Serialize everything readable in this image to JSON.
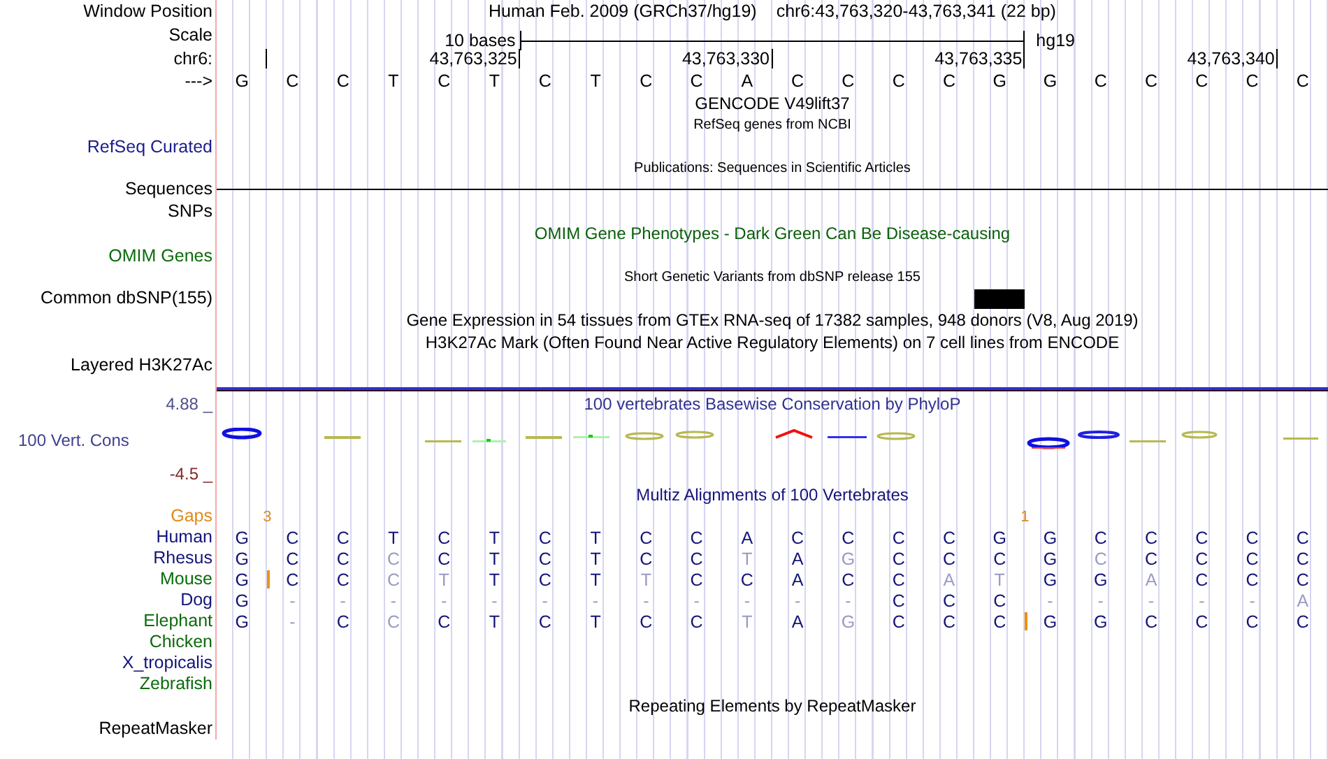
{
  "header": {
    "label": "Window Position",
    "assembly": "Human Feb. 2009 (GRCh37/hg19)",
    "position": "chr6:43,763,320-43,763,341 (22 bp)"
  },
  "scale": {
    "label": "Scale",
    "span": "10 bases",
    "assembly": "hg19"
  },
  "ruler": {
    "label": "chr6:",
    "ticks": [
      "43,763,325",
      "43,763,330",
      "43,763,335",
      "43,763,340"
    ]
  },
  "sequence": {
    "label": "--->",
    "bases": [
      "G",
      "C",
      "C",
      "T",
      "C",
      "T",
      "C",
      "T",
      "C",
      "C",
      "A",
      "C",
      "C",
      "C",
      "C",
      "G",
      "G",
      "C",
      "C",
      "C",
      "C",
      "C"
    ]
  },
  "tracks": [
    {
      "kind": "title",
      "text": "GENCODE V49lift37",
      "color": "#000000"
    },
    {
      "kind": "note",
      "text": "RefSeq genes from NCBI",
      "color": "#000000"
    },
    {
      "kind": "label",
      "label": "RefSeq Curated",
      "color": "#1c1c8c"
    },
    {
      "kind": "note",
      "text": "Publications: Sequences in Scientific Articles",
      "color": "#000000"
    },
    {
      "kind": "line",
      "label": "Sequences",
      "color": "#000000"
    },
    {
      "kind": "label",
      "label": "SNPs",
      "color": "#000000"
    },
    {
      "kind": "title",
      "text": "OMIM Gene Phenotypes - Dark Green Can Be Disease-causing",
      "color": "#0b5f0b"
    },
    {
      "kind": "label",
      "label": "OMIM Genes",
      "color": "#0b6b0b"
    },
    {
      "kind": "note",
      "text": "Short Genetic Variants from dbSNP release 155",
      "color": "#000000"
    },
    {
      "kind": "snp",
      "label": "Common dbSNP(155)",
      "color": "#000000"
    },
    {
      "kind": "title",
      "text": "Gene Expression in 54 tissues from GTEx RNA-seq of 17382 samples, 948 donors (V8, Aug 2019)",
      "color": "#000000"
    },
    {
      "kind": "title",
      "text": "H3K27Ac Mark (Often Found Near Active Regulatory Elements) on 7 cell lines from ENCODE",
      "color": "#000000"
    },
    {
      "kind": "label",
      "label": "Layered H3K27Ac",
      "color": "#000000"
    },
    {
      "kind": "conservation",
      "title": "100 vertebrates Basewise Conservation by PhyloP",
      "label": "100 Vert. Cons",
      "max": "4.88 _",
      "min": "-4.5 _"
    },
    {
      "kind": "alignment",
      "title": "Multiz Alignments of 100 Vertebrates",
      "gaps_label": "Gaps",
      "species": [
        {
          "name": "Human",
          "color": "#14147a",
          "bases": [
            {
              "kind": "base",
              "b": "G",
              "dim": false
            },
            {
              "kind": "base",
              "b": "C",
              "dim": false
            },
            {
              "kind": "base",
              "b": "C",
              "dim": false
            },
            {
              "kind": "base",
              "b": "T",
              "dim": false
            },
            {
              "kind": "base",
              "b": "C",
              "dim": false
            },
            {
              "kind": "base",
              "b": "T",
              "dim": false
            },
            {
              "kind": "base",
              "b": "C",
              "dim": false
            },
            {
              "kind": "base",
              "b": "T",
              "dim": false
            },
            {
              "kind": "base",
              "b": "C",
              "dim": false
            },
            {
              "kind": "base",
              "b": "C",
              "dim": false
            },
            {
              "kind": "base",
              "b": "A",
              "dim": false
            },
            {
              "kind": "base",
              "b": "C",
              "dim": false
            },
            {
              "kind": "base",
              "b": "C",
              "dim": false
            },
            {
              "kind": "base",
              "b": "C",
              "dim": false
            },
            {
              "kind": "base",
              "b": "C",
              "dim": false
            },
            {
              "kind": "base",
              "b": "G",
              "dim": false
            },
            {
              "kind": "base",
              "b": "G",
              "dim": false
            },
            {
              "kind": "base",
              "b": "C",
              "dim": false
            },
            {
              "kind": "base",
              "b": "C",
              "dim": false
            },
            {
              "kind": "base",
              "b": "C",
              "dim": false
            },
            {
              "kind": "base",
              "b": "C",
              "dim": false
            },
            {
              "kind": "base",
              "b": "C",
              "dim": false
            }
          ]
        },
        {
          "name": "Rhesus",
          "color": "#14147a",
          "bases": [
            {
              "kind": "base",
              "b": "G",
              "dim": false
            },
            {
              "kind": "base",
              "b": "C",
              "dim": false
            },
            {
              "kind": "base",
              "b": "C",
              "dim": false
            },
            {
              "kind": "base",
              "b": "C",
              "dim": true
            },
            {
              "kind": "base",
              "b": "C",
              "dim": false
            },
            {
              "kind": "base",
              "b": "T",
              "dim": false
            },
            {
              "kind": "base",
              "b": "C",
              "dim": false
            },
            {
              "kind": "base",
              "b": "T",
              "dim": false
            },
            {
              "kind": "base",
              "b": "C",
              "dim": false
            },
            {
              "kind": "base",
              "b": "C",
              "dim": false
            },
            {
              "kind": "base",
              "b": "T",
              "dim": true
            },
            {
              "kind": "base",
              "b": "A",
              "dim": false
            },
            {
              "kind": "base",
              "b": "G",
              "dim": true
            },
            {
              "kind": "base",
              "b": "C",
              "dim": false
            },
            {
              "kind": "base",
              "b": "C",
              "dim": false
            },
            {
              "kind": "base",
              "b": "C",
              "dim": false
            },
            {
              "kind": "base",
              "b": "G",
              "dim": false
            },
            {
              "kind": "base",
              "b": "C",
              "dim": true
            },
            {
              "kind": "base",
              "b": "C",
              "dim": false
            },
            {
              "kind": "base",
              "b": "C",
              "dim": false
            },
            {
              "kind": "base",
              "b": "C",
              "dim": false
            },
            {
              "kind": "base",
              "b": "C",
              "dim": false
            }
          ]
        },
        {
          "name": "Mouse",
          "color": "#0b6b0b",
          "bases": [
            {
              "kind": "base",
              "b": "G",
              "dim": false
            },
            {
              "kind": "insert",
              "gap": "3"
            },
            {
              "kind": "base",
              "b": "C",
              "dim": false
            },
            {
              "kind": "base",
              "b": "C",
              "dim": false
            },
            {
              "kind": "base",
              "b": "C",
              "dim": true
            },
            {
              "kind": "base",
              "b": "T",
              "dim": true
            },
            {
              "kind": "base",
              "b": "T",
              "dim": false
            },
            {
              "kind": "base",
              "b": "C",
              "dim": false
            },
            {
              "kind": "base",
              "b": "T",
              "dim": false
            },
            {
              "kind": "base",
              "b": "T",
              "dim": true
            },
            {
              "kind": "base",
              "b": "C",
              "dim": false
            },
            {
              "kind": "base",
              "b": "C",
              "dim": false
            },
            {
              "kind": "base",
              "b": "A",
              "dim": false
            },
            {
              "kind": "base",
              "b": "C",
              "dim": false
            },
            {
              "kind": "base",
              "b": "C",
              "dim": false
            },
            {
              "kind": "base",
              "b": "A",
              "dim": true
            },
            {
              "kind": "base",
              "b": "T",
              "dim": true
            },
            {
              "kind": "base",
              "b": "G",
              "dim": false
            },
            {
              "kind": "base",
              "b": "G",
              "dim": false
            },
            {
              "kind": "base",
              "b": "A",
              "dim": true
            },
            {
              "kind": "base",
              "b": "C",
              "dim": false
            },
            {
              "kind": "base",
              "b": "C",
              "dim": false
            },
            {
              "kind": "base",
              "b": "C",
              "dim": false
            }
          ]
        },
        {
          "name": "Dog",
          "color": "#14147a",
          "bases": [
            {
              "kind": "base",
              "b": "G",
              "dim": false
            },
            {
              "kind": "base",
              "b": "-",
              "dim": true
            },
            {
              "kind": "base",
              "b": "-",
              "dim": true
            },
            {
              "kind": "base",
              "b": "-",
              "dim": true
            },
            {
              "kind": "base",
              "b": "-",
              "dim": true
            },
            {
              "kind": "base",
              "b": "-",
              "dim": true
            },
            {
              "kind": "base",
              "b": "-",
              "dim": true
            },
            {
              "kind": "base",
              "b": "-",
              "dim": true
            },
            {
              "kind": "base",
              "b": "-",
              "dim": true
            },
            {
              "kind": "base",
              "b": "-",
              "dim": true
            },
            {
              "kind": "base",
              "b": "-",
              "dim": true
            },
            {
              "kind": "base",
              "b": "-",
              "dim": true
            },
            {
              "kind": "base",
              "b": "-",
              "dim": true
            },
            {
              "kind": "base",
              "b": "C",
              "dim": false
            },
            {
              "kind": "base",
              "b": "C",
              "dim": false
            },
            {
              "kind": "base",
              "b": "C",
              "dim": false
            },
            {
              "kind": "base",
              "b": "-",
              "dim": true
            },
            {
              "kind": "base",
              "b": "-",
              "dim": true
            },
            {
              "kind": "base",
              "b": "-",
              "dim": true
            },
            {
              "kind": "base",
              "b": "-",
              "dim": true
            },
            {
              "kind": "base",
              "b": "-",
              "dim": true
            },
            {
              "kind": "base",
              "b": "A",
              "dim": true
            }
          ]
        },
        {
          "name": "Elephant",
          "color": "#0b6b0b",
          "bases": [
            {
              "kind": "base",
              "b": "G",
              "dim": false
            },
            {
              "kind": "base",
              "b": "-",
              "dim": true
            },
            {
              "kind": "base",
              "b": "C",
              "dim": false
            },
            {
              "kind": "base",
              "b": "C",
              "dim": true
            },
            {
              "kind": "base",
              "b": "C",
              "dim": false
            },
            {
              "kind": "base",
              "b": "T",
              "dim": false
            },
            {
              "kind": "base",
              "b": "C",
              "dim": false
            },
            {
              "kind": "base",
              "b": "T",
              "dim": false
            },
            {
              "kind": "base",
              "b": "C",
              "dim": false
            },
            {
              "kind": "base",
              "b": "C",
              "dim": false
            },
            {
              "kind": "base",
              "b": "T",
              "dim": true
            },
            {
              "kind": "base",
              "b": "A",
              "dim": false
            },
            {
              "kind": "base",
              "b": "G",
              "dim": true
            },
            {
              "kind": "base",
              "b": "C",
              "dim": false
            },
            {
              "kind": "base",
              "b": "C",
              "dim": false
            },
            {
              "kind": "base",
              "b": "C",
              "dim": false
            },
            {
              "kind": "insert",
              "gap": "1"
            },
            {
              "kind": "base",
              "b": "G",
              "dim": false
            },
            {
              "kind": "base",
              "b": "G",
              "dim": false
            },
            {
              "kind": "base",
              "b": "C",
              "dim": false
            },
            {
              "kind": "base",
              "b": "C",
              "dim": false
            },
            {
              "kind": "base",
              "b": "C",
              "dim": false
            },
            {
              "kind": "base",
              "b": "C",
              "dim": false
            }
          ]
        },
        {
          "name": "Chicken",
          "color": "#0b6b0b"
        },
        {
          "name": "X_tropicalis",
          "color": "#14147a"
        },
        {
          "name": "Zebrafish",
          "color": "#0b6b0b"
        }
      ]
    },
    {
      "kind": "title",
      "text": "Repeating Elements by RepeatMasker",
      "color": "#000000"
    },
    {
      "kind": "label",
      "label": "RepeatMasker",
      "color": "#000000"
    }
  ]
}
